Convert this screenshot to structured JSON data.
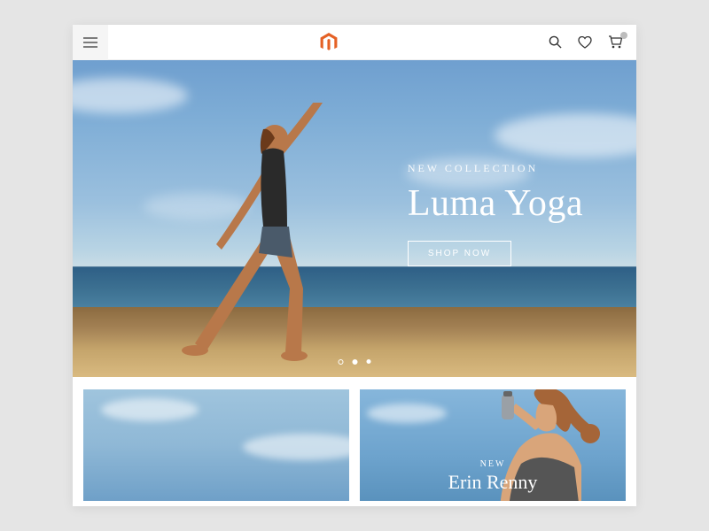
{
  "hero": {
    "eyebrow": "NEW COLLECTION",
    "title": "Luma Yoga",
    "cta": "SHOP NOW"
  },
  "carousel": {
    "count": 3,
    "active_index": 1
  },
  "cards": [
    {
      "eyebrow": "",
      "title": ""
    },
    {
      "eyebrow": "NEW",
      "title": "Erin Renny"
    }
  ],
  "cart": {
    "badge_count": 0
  }
}
